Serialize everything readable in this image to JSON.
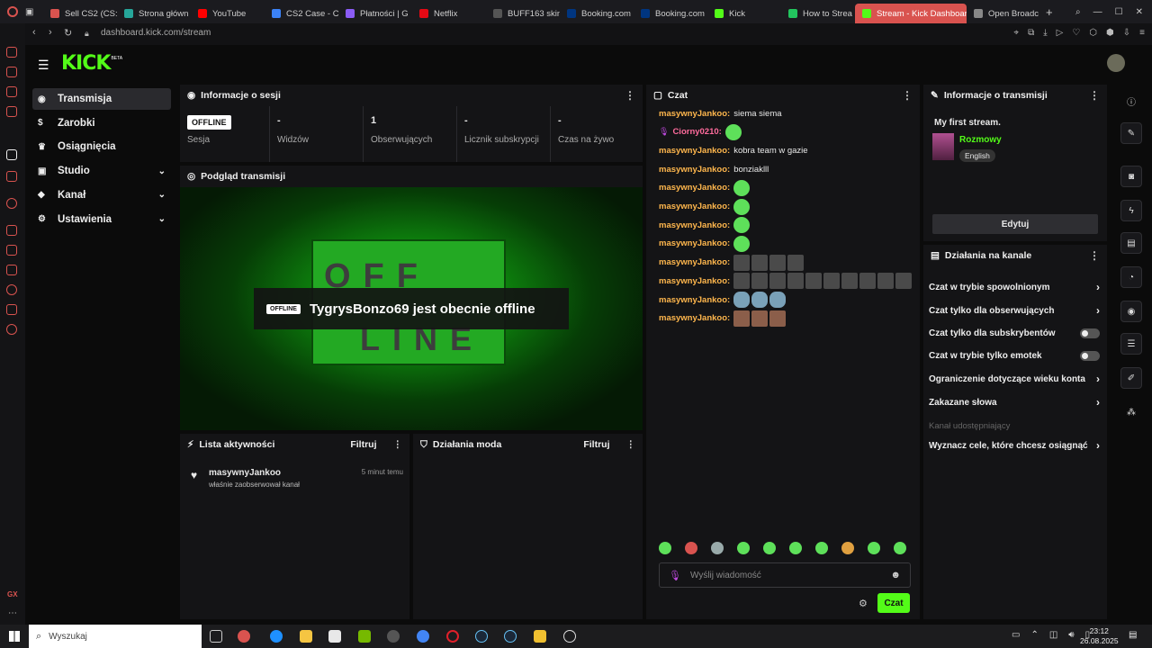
{
  "browser": {
    "tabs": [
      {
        "label": "Sell CS2 (CS:",
        "color": "#d9534f"
      },
      {
        "label": "Strona główn",
        "color": "#26a69a"
      },
      {
        "label": "YouTube",
        "color": "#ff0000"
      },
      {
        "label": "CS2 Case - C",
        "color": "#3b82f6"
      },
      {
        "label": "Płatności | G",
        "color": "#8b5cf6"
      },
      {
        "label": "Netflix",
        "color": "#e50914"
      },
      {
        "label": "BUFF163 skin",
        "color": "#555555"
      },
      {
        "label": "Booking.com",
        "color": "#003580"
      },
      {
        "label": "Booking.com",
        "color": "#003580"
      },
      {
        "label": "Kick",
        "color": "#53fc18"
      },
      {
        "label": "How to Strea",
        "color": "#22c55e"
      },
      {
        "label": "Stream - Kick Dashboard",
        "color": "#53fc18",
        "active": true
      },
      {
        "label": "Open Broadc",
        "color": "#888888"
      }
    ],
    "url": "dashboard.kick.com/stream",
    "accent": "#d9534f"
  },
  "header": {
    "logo": "KICK",
    "logo_sup": "BETA",
    "logo_color": "#53fc18"
  },
  "sidebar": {
    "items": [
      {
        "label": "Transmisja",
        "active": true,
        "icon": "broadcast-icon"
      },
      {
        "label": "Zarobki",
        "icon": "dollar-icon"
      },
      {
        "label": "Osiągnięcia",
        "icon": "trophy-icon"
      },
      {
        "label": "Studio",
        "icon": "studio-icon",
        "expandable": true
      },
      {
        "label": "Kanał",
        "icon": "channel-icon",
        "expandable": true
      },
      {
        "label": "Ustawienia",
        "icon": "settings-icon",
        "expandable": true
      }
    ]
  },
  "session": {
    "title": "Informacje o sesji",
    "badge": "OFFLINE",
    "stats": [
      {
        "value": "",
        "label": "Sesja"
      },
      {
        "value": "-",
        "label": "Widzów"
      },
      {
        "value": "1",
        "label": "Obserwujących"
      },
      {
        "value": "-",
        "label": "Licznik subskrypcji"
      },
      {
        "value": "-",
        "label": "Czas na żywo"
      }
    ]
  },
  "preview": {
    "title": "Podgląd transmisji",
    "badge": "OFFLINE",
    "message": "TygrysBonzo69 jest obecnie offline",
    "sign_top": "OFF",
    "sign_bottom": "LINE"
  },
  "activity": {
    "title": "Lista aktywności",
    "filter": "Filtruj",
    "items": [
      {
        "user": "masywnyJankoo",
        "text": "właśnie zaobserwował kanał",
        "time": "5 minut temu"
      }
    ]
  },
  "mod": {
    "title": "Działania moda",
    "filter": "Filtruj"
  },
  "chat": {
    "title": "Czat",
    "messages": [
      {
        "user": "masywnyJankoo:",
        "text": "siema siema",
        "emotes": 0
      },
      {
        "user": "Ciorny0210:",
        "text": "",
        "emotes": 1,
        "pink": true
      },
      {
        "user": "masywnyJankoo:",
        "text": "kobra team w gazie",
        "emotes": 0
      },
      {
        "user": "masywnyJankoo:",
        "text": "bonziaklll",
        "emotes": 0
      },
      {
        "user": "masywnyJankoo:",
        "text": "",
        "emotes": 1
      },
      {
        "user": "masywnyJankoo:",
        "text": "",
        "emotes": 1
      },
      {
        "user": "masywnyJankoo:",
        "text": "",
        "emotes": 1
      },
      {
        "user": "masywnyJankoo:",
        "text": "",
        "emotes": 1
      },
      {
        "user": "masywnyJankoo:",
        "text": "",
        "emotes": 4,
        "kind": "sq"
      },
      {
        "user": "masywnyJankoo:",
        "text": "",
        "emotes": 10,
        "kind": "sq"
      },
      {
        "user": "masywnyJankoo:",
        "text": "",
        "emotes": 3,
        "kind": "pear"
      },
      {
        "user": "masywnyJankoo:",
        "text": "",
        "emotes": 3,
        "kind": "face"
      }
    ],
    "placeholder": "Wyślij wiadomość",
    "send": "Czat"
  },
  "stream_info": {
    "title": "Informacje o transmisji",
    "stream_title": "My first stream.",
    "category": "Rozmowy",
    "language": "English",
    "edit": "Edytuj"
  },
  "channel_actions": {
    "title": "Działania na kanale",
    "items": [
      {
        "label": "Czat w trybie spowolnionym",
        "type": "arrow"
      },
      {
        "label": "Czat tylko dla obserwujących",
        "type": "arrow"
      },
      {
        "label": "Czat tylko dla subskrybentów",
        "type": "toggle"
      },
      {
        "label": "Czat w trybie tylko emotek",
        "type": "toggle"
      },
      {
        "label": "Ograniczenie dotyczące wieku konta",
        "type": "arrow"
      },
      {
        "label": "Zakazane słowa",
        "type": "arrow"
      },
      {
        "label": "Kanał udostępniający",
        "type": "disabled"
      },
      {
        "label": "Wyznacz cele, które chcesz osiągnąć",
        "type": "arrow"
      }
    ]
  },
  "taskbar": {
    "search": "Wyszukaj",
    "time": "23:12",
    "date": "26.08.2025"
  }
}
